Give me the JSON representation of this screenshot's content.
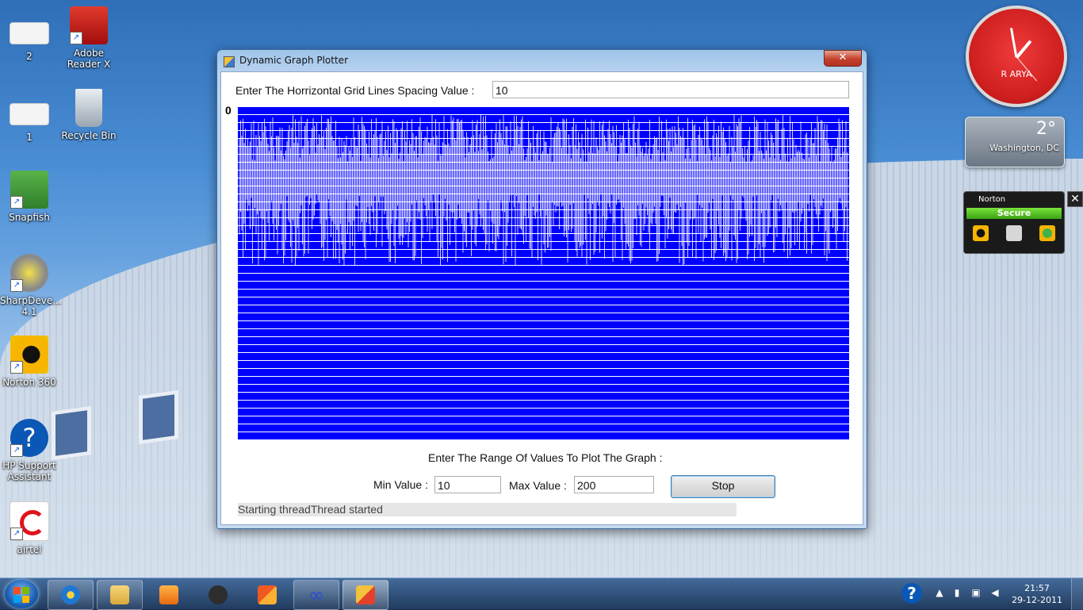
{
  "desktop": {
    "icons": [
      {
        "label": "2",
        "icon": "document-thumbnail-icon"
      },
      {
        "label": "Adobe Reader X",
        "icon": "adobe-reader-icon"
      },
      {
        "label": "1",
        "icon": "document-thumbnail-icon"
      },
      {
        "label": "Recycle Bin",
        "icon": "recycle-bin-icon"
      },
      {
        "label": "Snapfish",
        "icon": "snapfish-icon"
      },
      {
        "label": "SharpDeve... 4.1",
        "icon": "sharpdevelop-icon"
      },
      {
        "label": "Norton 360",
        "icon": "norton-icon"
      },
      {
        "label": "HP Support Assistant",
        "icon": "hp-support-icon"
      },
      {
        "label": "airtel",
        "icon": "airtel-icon"
      }
    ]
  },
  "gadgets": {
    "clock_name": "R ARYA",
    "weather_temp": "2°",
    "weather_city": "Washington, DC",
    "norton_brand": "Norton",
    "norton_status": "Secure",
    "close_glyph": "✕"
  },
  "window": {
    "title": "Dynamic Graph Plotter",
    "close_glyph": "✕",
    "grid_label": "Enter The Horrizontal Grid Lines Spacing Value :",
    "grid_value": "10",
    "graph_origin_label": "0",
    "range_label": "Enter The Range Of Values To Plot The Graph :",
    "min_label": "Min Value :",
    "min_value": "10",
    "max_label": "Max Value :",
    "max_value": "200",
    "stop_label": "Stop",
    "status_text": "Starting threadThread started"
  },
  "taskbar": {
    "time": "21:57",
    "date": "29-12-2011",
    "help_glyph": "?",
    "apps": [
      "internet-explorer-icon",
      "file-explorer-icon",
      "media-player-icon",
      "hp-icon",
      "office-icon",
      "infinity-app-icon",
      "graph-plotter-app-icon"
    ]
  },
  "colors": {
    "graph_bg": "#0000ff",
    "graph_line": "#ffffff",
    "clock_face": "#d42222",
    "norton_green": "#4cc41f"
  }
}
